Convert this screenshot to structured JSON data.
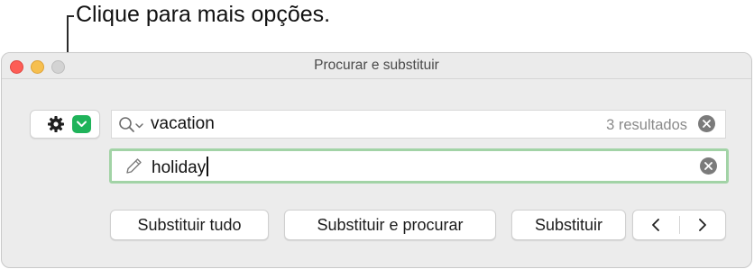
{
  "callout": {
    "text": "Clique para mais opções."
  },
  "window": {
    "title": "Procurar e substituir"
  },
  "toolbar": {
    "options_icon": "gear-icon",
    "options_dropdown_icon": "chevron-down-icon"
  },
  "search": {
    "value": "vacation",
    "results": "3 resultados",
    "icon": "magnifier-dropdown-icon"
  },
  "replace": {
    "value": "holiday",
    "icon": "pencil-icon",
    "focus_color": "#a2d3a6"
  },
  "buttons": {
    "replace_all": "Substituir tudo",
    "replace_and_find": "Substituir e procurar",
    "replace": "Substituir",
    "previous_icon": "chevron-left-icon",
    "next_icon": "chevron-right-icon"
  },
  "colors": {
    "accent_green": "#1fb35a",
    "close": "#fd5d56",
    "minimize": "#f6bf4f",
    "zoom_inactive": "#d3d3d3"
  }
}
